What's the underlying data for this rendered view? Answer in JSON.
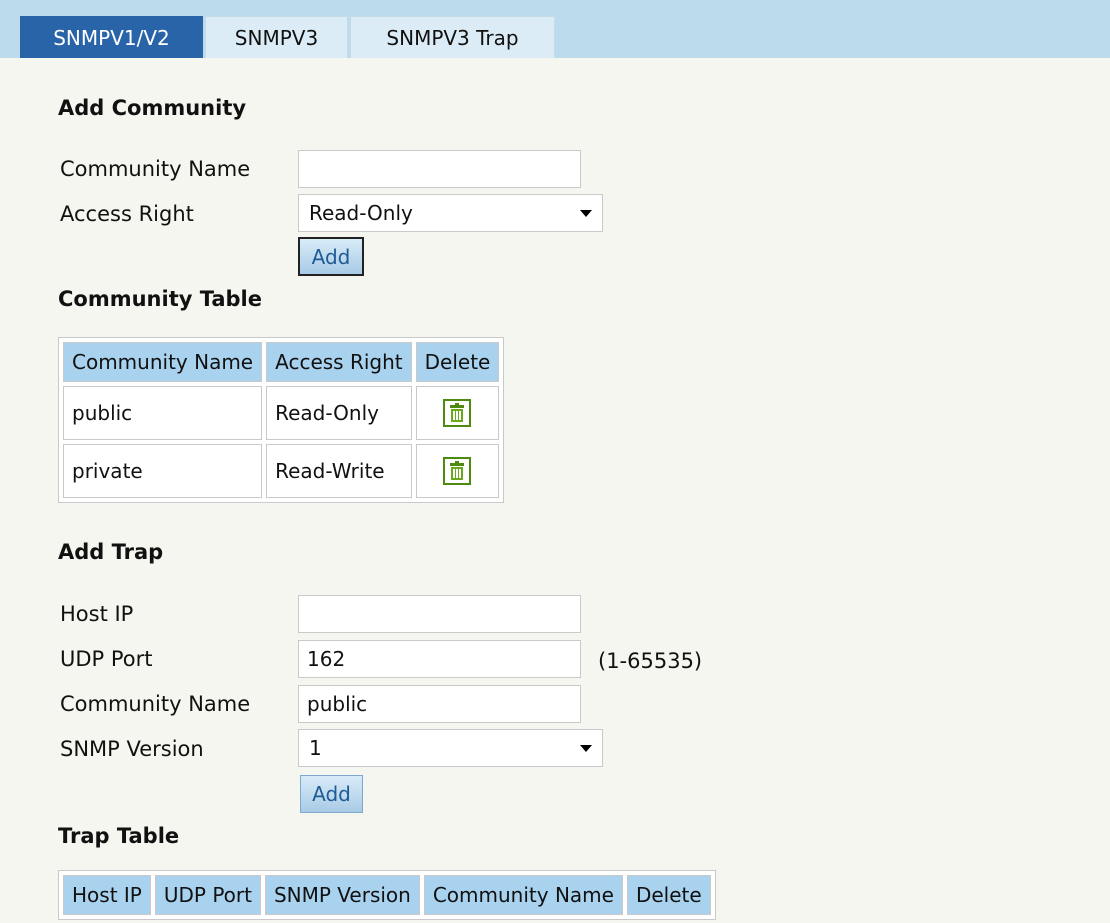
{
  "tabs": [
    {
      "label": "SNMPV1/V2",
      "active": true
    },
    {
      "label": "SNMPV3",
      "active": false
    },
    {
      "label": "SNMPV3 Trap",
      "active": false
    }
  ],
  "add_community": {
    "heading": "Add Community",
    "community_name_label": "Community Name",
    "community_name_value": "",
    "access_right_label": "Access Right",
    "access_right_value": "Read-Only",
    "add_label": "Add"
  },
  "community_table": {
    "heading": "Community Table",
    "columns": [
      "Community Name",
      "Access Right",
      "Delete"
    ],
    "rows": [
      {
        "name": "public",
        "access": "Read-Only",
        "delete_icon": "trash-icon"
      },
      {
        "name": "private",
        "access": "Read-Write",
        "delete_icon": "trash-icon"
      }
    ]
  },
  "add_trap": {
    "heading": "Add Trap",
    "host_ip_label": "Host IP",
    "host_ip_value": "",
    "udp_port_label": "UDP Port",
    "udp_port_value": "162",
    "udp_port_range": "(1-65535)",
    "community_name_label": "Community Name",
    "community_name_value": "public",
    "snmp_version_label": "SNMP Version",
    "snmp_version_value": "1",
    "add_label": "Add"
  },
  "trap_table": {
    "heading": "Trap Table",
    "columns": [
      "Host IP",
      "UDP Port",
      "SNMP Version",
      "Community Name",
      "Delete"
    ]
  },
  "colors": {
    "tab_active": "#2a64a8",
    "tab_bar": "#bcdcee",
    "table_header": "#a9d2ef",
    "page_background": "#f4f6ef",
    "trash_icon": "#4f8a10"
  }
}
